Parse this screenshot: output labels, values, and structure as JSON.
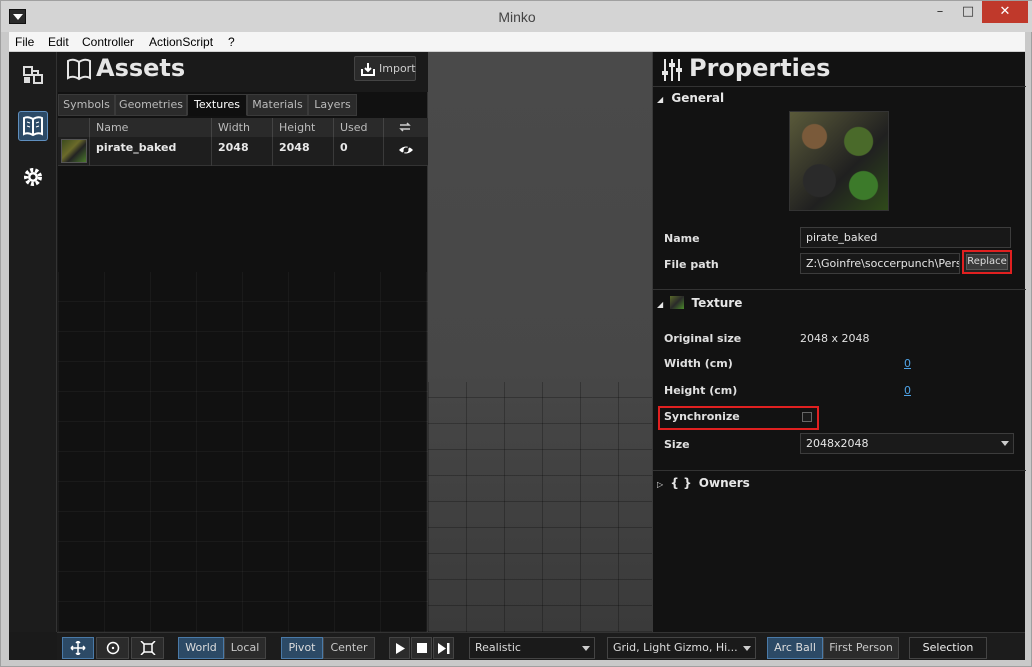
{
  "window": {
    "title": "Minko"
  },
  "menubar": {
    "items": [
      "File",
      "Edit",
      "Controller",
      "ActionScript",
      "?"
    ]
  },
  "assets": {
    "title": "Assets",
    "import_label": "Import",
    "tabs": [
      "Symbols",
      "Geometries",
      "Textures",
      "Materials",
      "Layers"
    ],
    "active_tab": "Textures",
    "columns": [
      "Name",
      "Width",
      "Height",
      "Used"
    ],
    "rows": [
      {
        "name": "pirate_baked",
        "width": "2048",
        "height": "2048",
        "used": "0"
      }
    ]
  },
  "properties": {
    "title": "Properties",
    "general": {
      "header": "General",
      "name_label": "Name",
      "name_value": "pirate_baked",
      "filepath_label": "File path",
      "filepath_value": "Z:\\Goinfre\\soccerpunch\\Persor",
      "replace_label": "Replace"
    },
    "texture": {
      "header": "Texture",
      "original_size_label": "Original size",
      "original_size_value": "2048 x 2048",
      "width_label": "Width (cm)",
      "width_value": "0",
      "height_label": "Height (cm)",
      "height_value": "0",
      "sync_label": "Synchronize",
      "size_label": "Size",
      "size_value": "2048x2048"
    },
    "owners": {
      "header": "Owners"
    }
  },
  "bottombar": {
    "world": "World",
    "local": "Local",
    "pivot": "Pivot",
    "center": "Center",
    "render_mode": "Realistic",
    "display_options": "Grid, Light Gizmo, Hi...",
    "arc_ball": "Arc Ball",
    "first_person": "First Person",
    "selection": "Selection"
  }
}
